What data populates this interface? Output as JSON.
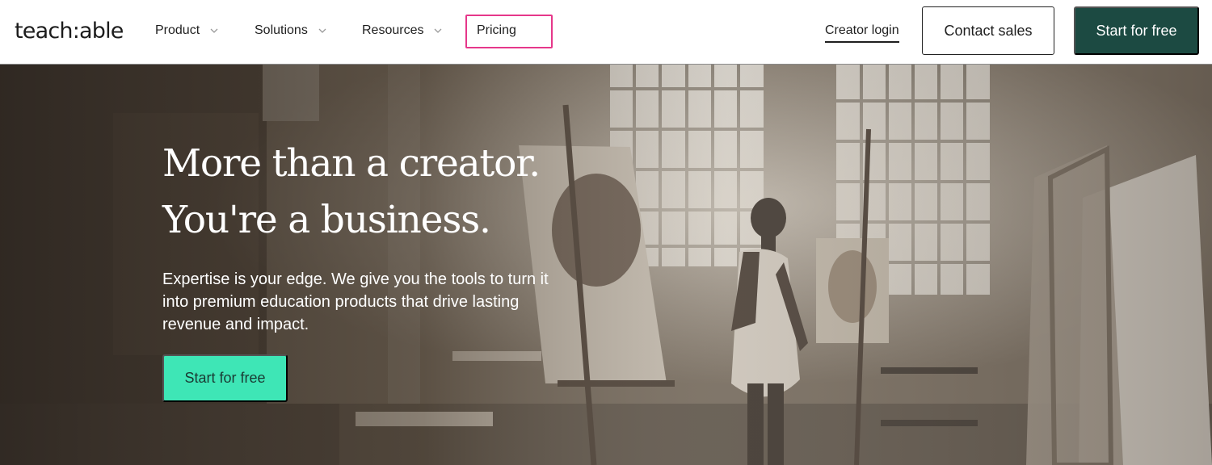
{
  "header": {
    "logo_text": "teach:able",
    "nav": [
      {
        "label": "Product",
        "has_dropdown": true
      },
      {
        "label": "Solutions",
        "has_dropdown": true
      },
      {
        "label": "Resources",
        "has_dropdown": true
      },
      {
        "label": "Pricing",
        "has_dropdown": false
      }
    ],
    "creator_login": "Creator login",
    "contact_sales": "Contact sales",
    "start_free": "Start for free"
  },
  "hero": {
    "title_line1": "More than a creator.",
    "title_line2": "You're a business.",
    "subtitle": "Expertise is your edge. We give you the tools to turn it into premium education products that drive lasting revenue and impact.",
    "cta": "Start for free",
    "background": "photo of an artist painting in a sunlit studio with easels and large windows"
  },
  "colors": {
    "brand_dark": "#1c4a42",
    "brand_accent": "#3ee6b6",
    "highlight": "#e6378a"
  }
}
